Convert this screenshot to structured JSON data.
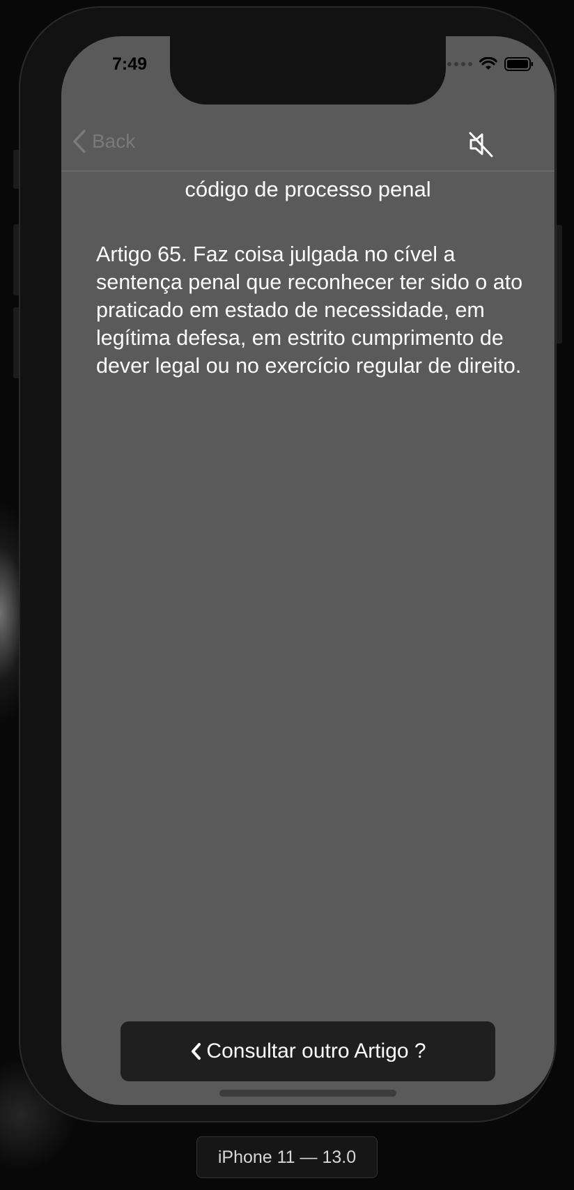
{
  "status_bar": {
    "time": "7:49"
  },
  "navbar": {
    "back_label": "Back",
    "mute_icon": "speaker-muted-icon"
  },
  "content": {
    "code_title": "código de processo penal",
    "article_text": "Artigo  65. Faz coisa julgada no cível a sentença penal que reconhecer ter sido o ato praticado em estado de necessidade, em legítima defesa, em estrito cumprimento de dever legal ou no exercício regular de direito."
  },
  "footer": {
    "consult_button_label": "Consultar outro Artigo ?"
  },
  "simulator": {
    "device_label": "iPhone 11 — 13.0"
  },
  "colors": {
    "screen_background": "#5a5a5a",
    "button_background": "#1f1f1f",
    "text": "#ffffff",
    "nav_tint": "#7a7a7a"
  }
}
